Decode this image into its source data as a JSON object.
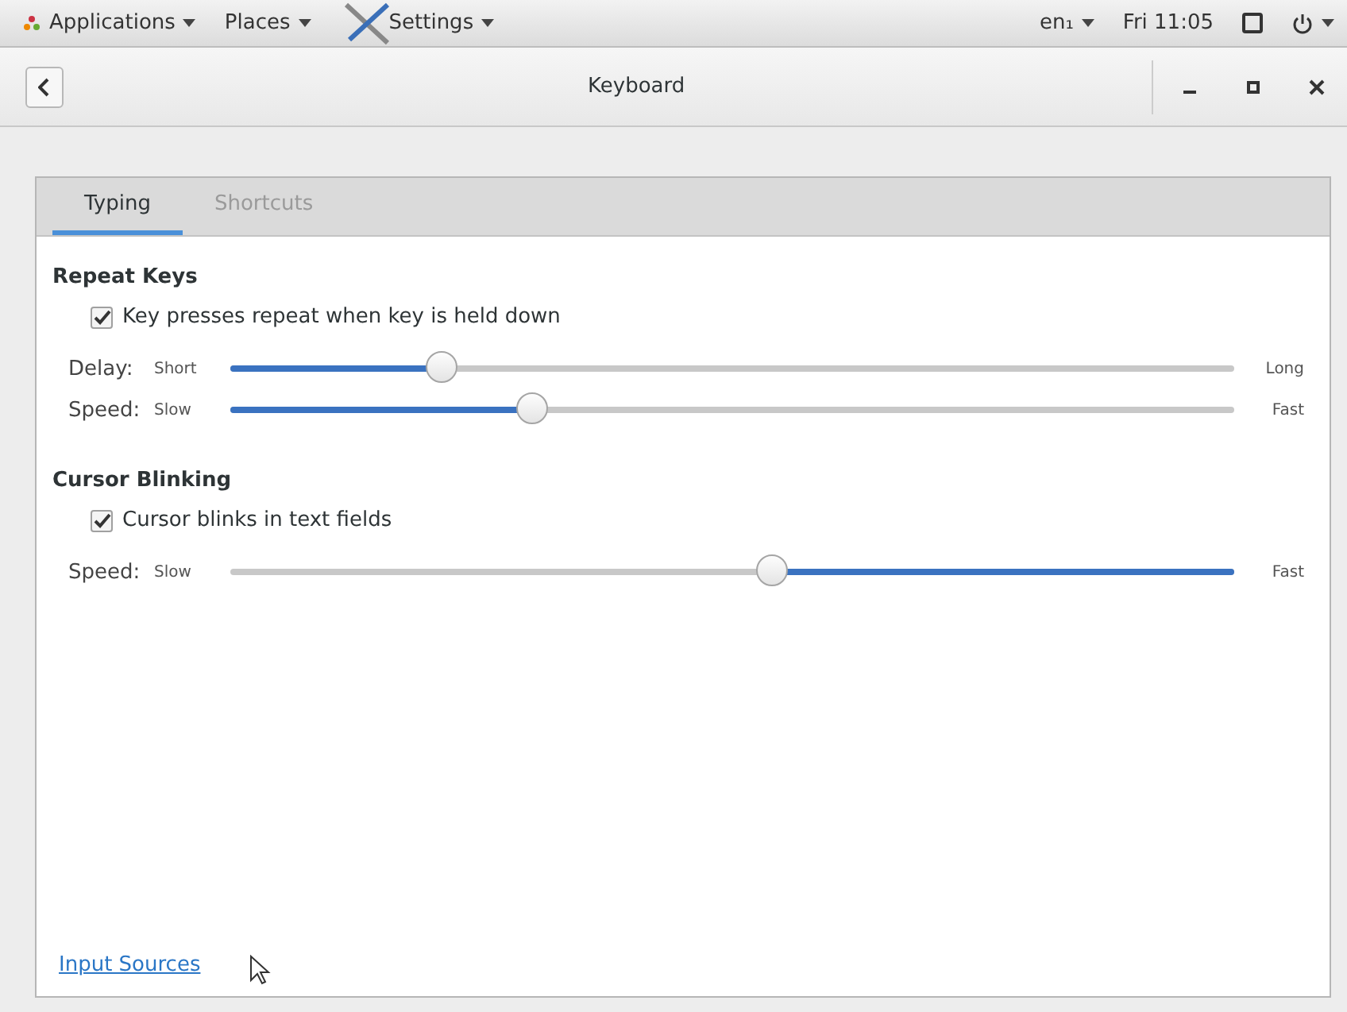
{
  "top_bar": {
    "menus": [
      {
        "label": "Applications",
        "kind": "apps"
      },
      {
        "label": "Places",
        "kind": "plain"
      },
      {
        "label": "Settings",
        "kind": "settings"
      }
    ],
    "language": "en₁",
    "clock": "Fri 11:05"
  },
  "window": {
    "title": "Keyboard"
  },
  "tabs": [
    {
      "label": "Typing",
      "selected": true
    },
    {
      "label": "Shortcuts",
      "selected": false
    }
  ],
  "sections": [
    {
      "title": "Repeat Keys",
      "checkbox": {
        "label": "Key presses repeat when key is held down",
        "checked": true
      },
      "sliders": [
        {
          "label": "Delay:",
          "min_label": "Short",
          "max_label": "Long",
          "level": 0.21,
          "inverted": false
        },
        {
          "label": "Speed:",
          "min_label": "Slow",
          "max_label": "Fast",
          "level": 0.3,
          "inverted": false
        }
      ]
    },
    {
      "title": "Cursor Blinking",
      "checkbox": {
        "label": "Cursor blinks in text fields",
        "checked": true
      },
      "sliders": [
        {
          "label": "Speed:",
          "min_label": "Slow",
          "max_label": "Fast",
          "level": 0.54,
          "inverted": true
        }
      ]
    }
  ],
  "link": "Input Sources"
}
